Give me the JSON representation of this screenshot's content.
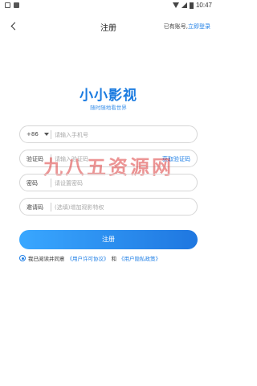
{
  "status_bar": {
    "time": "10:47"
  },
  "nav": {
    "title": "注册",
    "has_account": "已有账号,",
    "login_link": "立即登录"
  },
  "brand": {
    "logo": "小小影视",
    "slogan": "随时随地看世界"
  },
  "form": {
    "phone": {
      "country_code": "+86",
      "placeholder": "请输入手机号",
      "value": ""
    },
    "code": {
      "label": "验证码",
      "placeholder": "请输入验证码",
      "value": "",
      "get_code": "获取验证码"
    },
    "password": {
      "label": "密码",
      "placeholder": "请设置密码",
      "value": ""
    },
    "invite": {
      "label": "邀请码",
      "placeholder": "(选填)增加观影特权",
      "value": ""
    }
  },
  "watermark": "九八五资源网",
  "submit_label": "注册",
  "agreement": {
    "prefix": "我已阅读并同意",
    "user_agreement": "《用户许可协议》",
    "and": "和",
    "privacy_policy": "《用户隐私政策》",
    "checked": true
  },
  "colors": {
    "accent": "#1f7fe6",
    "button_start": "#39a7ff",
    "button_end": "#1f77e0",
    "watermark": "#dc3c3c"
  }
}
